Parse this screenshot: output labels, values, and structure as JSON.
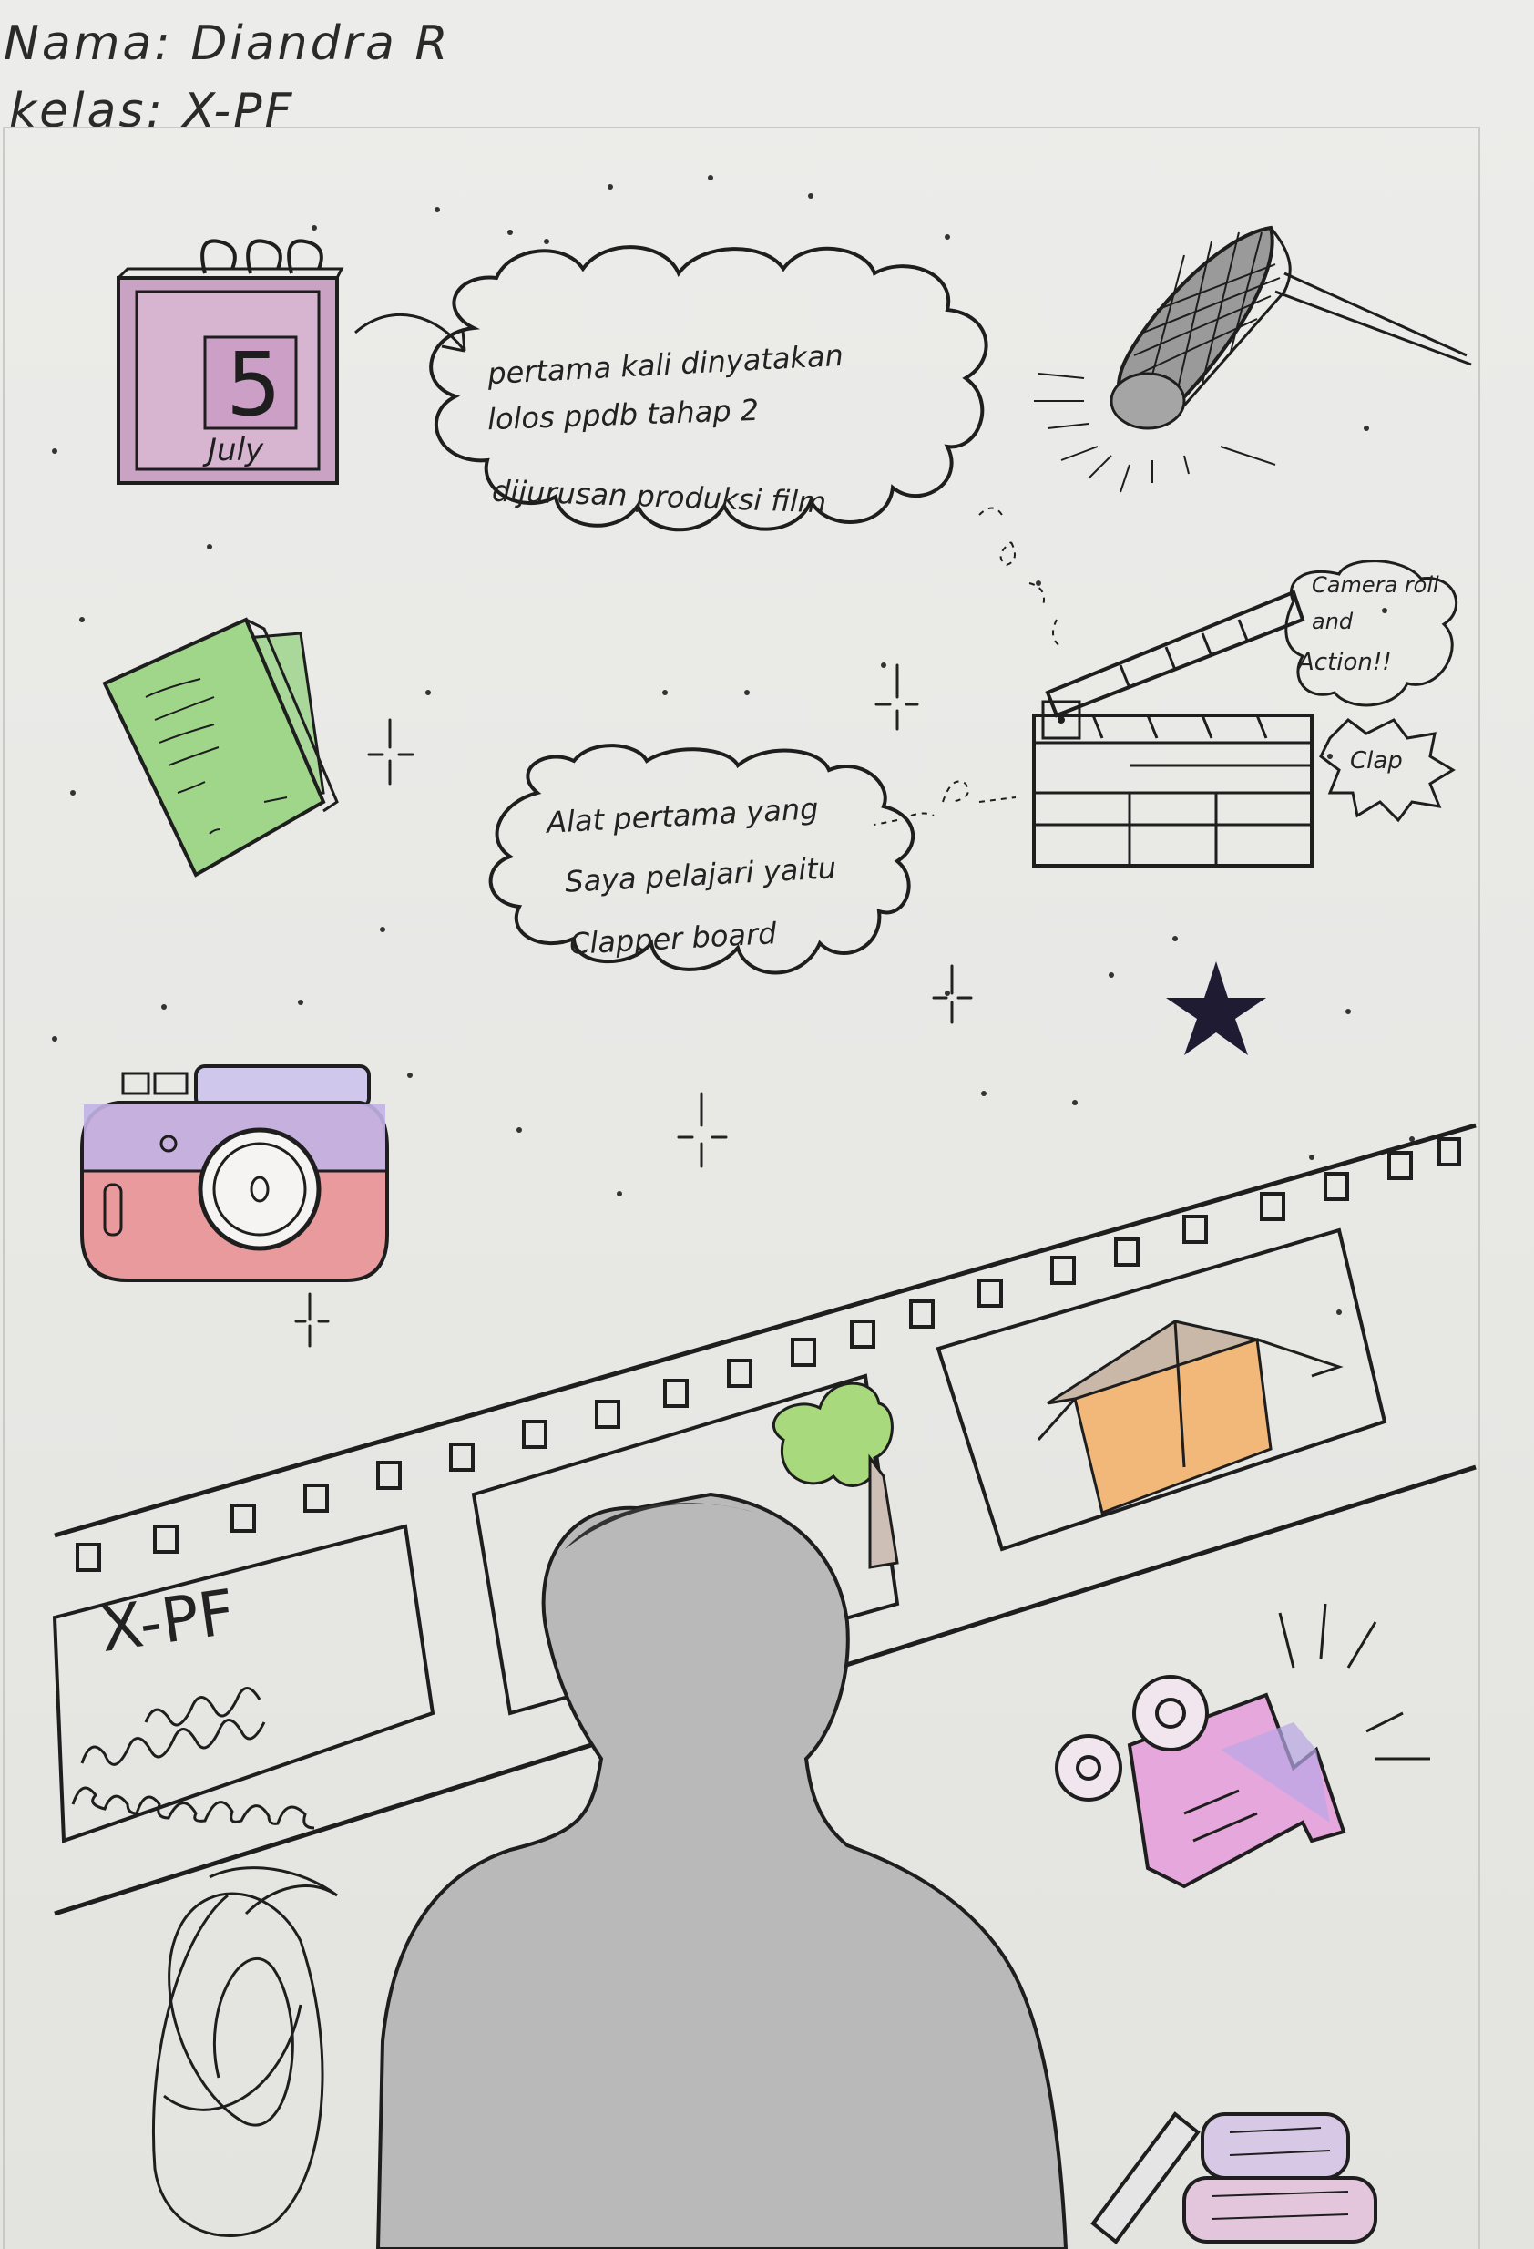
{
  "header": {
    "name_line": "Nama: Diandra R",
    "class_line": "kelas: X-PF"
  },
  "calendar": {
    "day": "5",
    "month": "July"
  },
  "bubble_one": {
    "lines": [
      "pertama kali dinyatakan",
      "lolos ppdb tahap 2",
      "dijurusan produksi film"
    ]
  },
  "bubble_two": {
    "lines": [
      "Alat pertama yang",
      "Saya pelajari yaitu",
      "Clapper board"
    ]
  },
  "clapper_callout": {
    "lines": [
      "Camera roll",
      "and",
      "Action!!"
    ],
    "clap": "Clap"
  },
  "film_frame_one": {
    "class_label": "X-PF"
  },
  "colors": {
    "ink": "#1e1e1e",
    "calendar_fill": "#c9a2c4",
    "book_fill": "#9fd68a",
    "camera_top": "#c2b3e6",
    "camera_body": "#e89a9c",
    "box_fill": "#f2b879",
    "tree_fill": "#a8d97c",
    "silhouette": "#b9b9b9",
    "projector_fill": "#e6a7dd"
  }
}
